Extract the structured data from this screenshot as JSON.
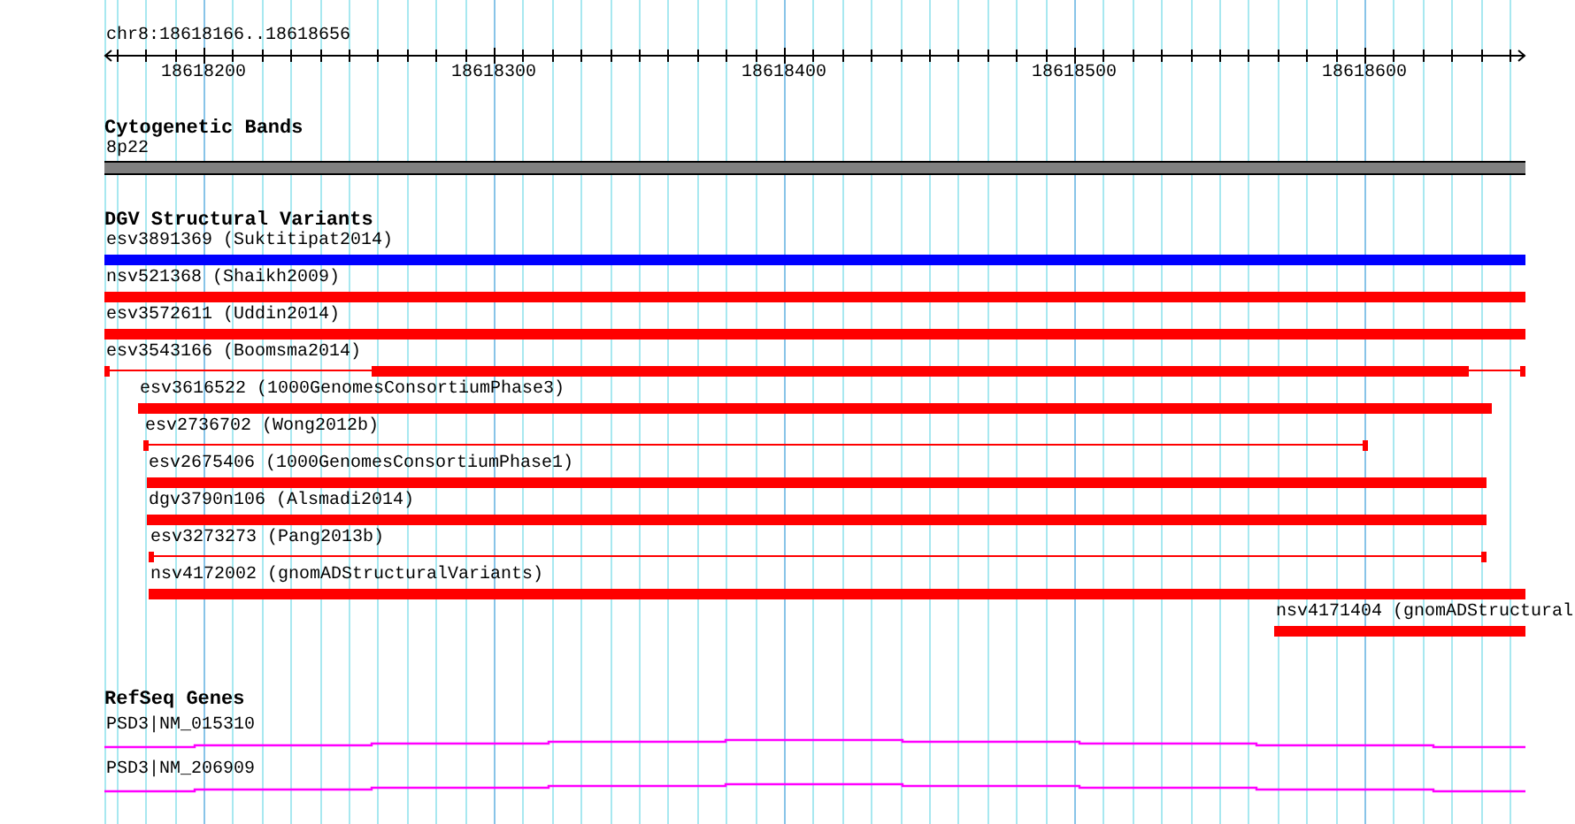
{
  "ruler": {
    "location": "chr8:18618166..18618656",
    "ticks": [
      "18618200",
      "18618300",
      "18618400",
      "18618500",
      "18618600"
    ]
  },
  "cytoband_track": {
    "title": "Cytogenetic Bands",
    "band": "8p22"
  },
  "variant_track": {
    "title": "DGV Structural Variants",
    "features": [
      {
        "label": "esv3891369 (Suktitipat2014)",
        "kind": "solid",
        "color": "#0000ff"
      },
      {
        "label": "nsv521368 (Shaikh2009)",
        "kind": "solid",
        "color": "#ff0000"
      },
      {
        "label": "esv3572611 (Uddin2014)",
        "kind": "solid",
        "color": "#ff0000"
      },
      {
        "label": "esv3543166 (Boomsma2014)",
        "kind": "split",
        "color": "#ff0000"
      },
      {
        "label": "esv3616522 (1000GenomesConsortiumPhase3)",
        "kind": "solid",
        "color": "#ff0000"
      },
      {
        "label": "esv2736702 (Wong2012b)",
        "kind": "thin",
        "color": "#ff0000"
      },
      {
        "label": "esv2675406 (1000GenomesConsortiumPhase1)",
        "kind": "solid",
        "color": "#ff0000"
      },
      {
        "label": "dgv3790n106 (Alsmadi2014)",
        "kind": "solid",
        "color": "#ff0000"
      },
      {
        "label": "esv3273273 (Pang2013b)",
        "kind": "thin",
        "color": "#ff0000"
      },
      {
        "label": "nsv4172002 (gnomADStructuralVariants)",
        "kind": "solid",
        "color": "#ff0000"
      },
      {
        "label": "nsv4171404 (gnomADStructural",
        "kind": "solid",
        "color": "#ff0000"
      }
    ]
  },
  "gene_track": {
    "title": "RefSeq Genes",
    "genes": [
      {
        "label": "PSD3|NM_015310"
      },
      {
        "label": "PSD3|NM_206909"
      }
    ]
  }
}
